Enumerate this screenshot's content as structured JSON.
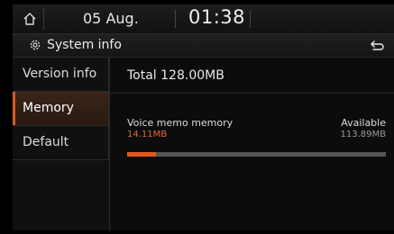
{
  "status_bar": {
    "home_icon": "home-icon",
    "date": "05 Aug.",
    "time": "01:38"
  },
  "title_bar": {
    "icon": "gear-icon",
    "title": "System info",
    "back_icon": "back-icon"
  },
  "sidebar": {
    "items": [
      {
        "label": "Version info",
        "active": false
      },
      {
        "label": "Memory",
        "active": true
      },
      {
        "label": "Default",
        "active": false
      }
    ]
  },
  "memory": {
    "total": "Total 128.00MB",
    "voice_label": "Voice memo memory",
    "available_label": "Available",
    "used_value": "14.11MB",
    "available_value": "113.89MB",
    "used_fraction": 0.11,
    "accent_color": "#e2571f"
  }
}
